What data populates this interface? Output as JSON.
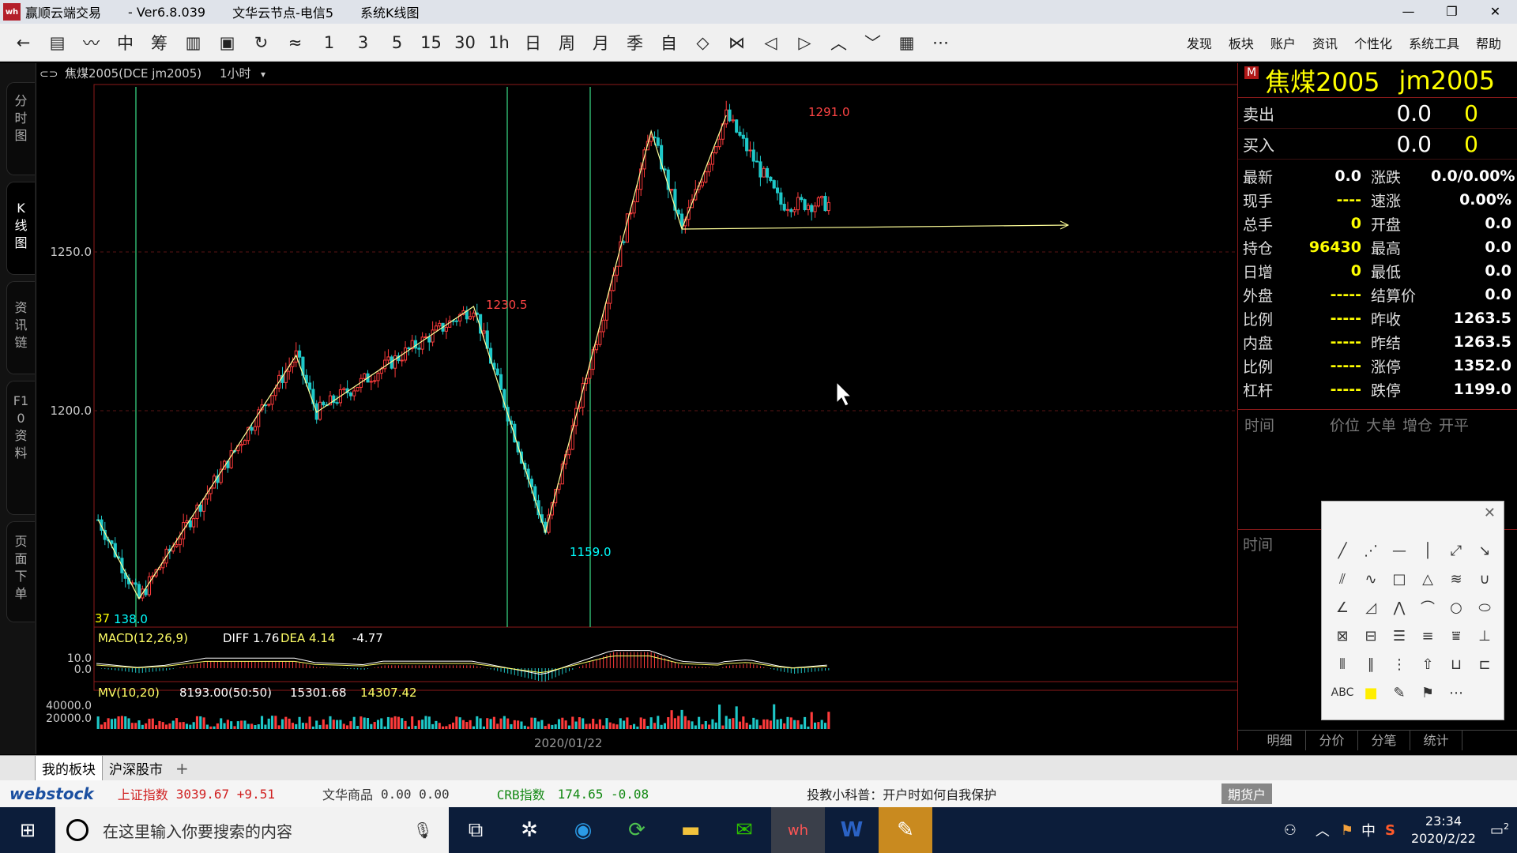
{
  "window": {
    "logo": "wh",
    "app_name": "赢顺云端交易",
    "version": "- Ver6.8.039",
    "server": "文华云节点-电信5",
    "module": "系统K线图",
    "controls": [
      "—",
      "❐",
      "✕"
    ]
  },
  "toolbar": {
    "buttons": [
      "←",
      "▤",
      "〰",
      "中",
      "筹",
      "▥",
      "▣",
      "↻",
      "≈",
      "1",
      "3",
      "5",
      "15",
      "30",
      "1h",
      "日",
      "周",
      "月",
      "季",
      "自",
      "◇",
      "⋈",
      "◁",
      "▷",
      "︿",
      "﹀",
      "▦",
      "⋯"
    ],
    "menu": [
      "发现",
      "板块",
      "账户",
      "资讯",
      "个性化",
      "系统工具",
      "帮助"
    ]
  },
  "left_rail": [
    "分时图",
    "K线图",
    "资讯链",
    "F10资料",
    "页面下单"
  ],
  "chart": {
    "symbol_line": "焦煤2005(DCE jm2005)",
    "period": "1小时",
    "price_ticks": [
      "1250.0",
      "1200.0"
    ],
    "macd_label": "MACD(12,26,9)",
    "macd_diff": "DIFF 1.76",
    "macd_dea": "DEA 4.14",
    "macd_value": "-4.77",
    "macd_ticks": [
      "10.0",
      "0.0"
    ],
    "mv_label": "MV(10,20)",
    "mv_values": [
      "8193.00(50:50)",
      "15301.68",
      "14307.42"
    ],
    "mv_ticks": [
      "40000.0",
      "20000.0"
    ],
    "date_label": "2020/01/22",
    "annotations": [
      "1291.0",
      "1230.5",
      "1159.0",
      "138.0",
      "37"
    ]
  },
  "chart_data": {
    "type": "candlestick",
    "ylim": [
      1130,
      1300
    ],
    "points": [
      {
        "label": "start",
        "value": 1163
      },
      {
        "label": "low",
        "value": 1138.0
      },
      {
        "label": "swing-high",
        "value": 1215
      },
      {
        "label": "swing-low",
        "value": 1197
      },
      {
        "label": "high",
        "value": 1230.5
      },
      {
        "label": "low",
        "value": 1159.0
      },
      {
        "label": "peak",
        "value": 1286
      },
      {
        "label": "pullback",
        "value": 1255
      },
      {
        "label": "high",
        "value": 1291.0
      },
      {
        "label": "last",
        "value": 1263
      }
    ]
  },
  "quote": {
    "badge": "M",
    "name": "焦煤2005",
    "code": "jm2005",
    "sell_label": "卖出",
    "sell_price": "0.0",
    "sell_qty": "0",
    "buy_label": "买入",
    "buy_price": "0.0",
    "buy_qty": "0",
    "rows": [
      {
        "l": "最新",
        "v": "0.0",
        "l2": "涨跌",
        "v2": "0.0/0.00%"
      },
      {
        "l": "现手",
        "v": "----",
        "l2": "速涨",
        "v2": "0.00%"
      },
      {
        "l": "总手",
        "v": "0",
        "l2": "开盘",
        "v2": "0.0"
      },
      {
        "l": "持仓",
        "v": "96430",
        "l2": "最高",
        "v2": "0.0"
      },
      {
        "l": "日增",
        "v": "0",
        "l2": "最低",
        "v2": "0.0"
      },
      {
        "l": "外盘",
        "v": "-----",
        "l2": "结算价",
        "v2": "0.0"
      },
      {
        "l": "比例",
        "v": "-----",
        "l2": "昨收",
        "v2": "1263.5"
      },
      {
        "l": "内盘",
        "v": "-----",
        "l2": "昨结",
        "v2": "1263.5"
      },
      {
        "l": "比例",
        "v": "-----",
        "l2": "涨停",
        "v2": "1352.0"
      },
      {
        "l": "杠杆",
        "v": "-----",
        "l2": "跌停",
        "v2": "1199.0"
      }
    ],
    "ticks_header": [
      "时间",
      "价位",
      "大单",
      "增仓",
      "开平"
    ],
    "ticks2_header": "时间",
    "tabs": [
      "明细",
      "分价",
      "分笔",
      "统计"
    ]
  },
  "draw_panel": {
    "close": "✕",
    "tools": [
      "╱",
      "⋰",
      "—",
      "│",
      "⤢",
      "↘",
      "⫽",
      "∿",
      "□",
      "△",
      "≋",
      "∪",
      "∠",
      "◿",
      "⋀",
      "⌒",
      "○",
      "⬭",
      "⊠",
      "⊟",
      "☰",
      "≡",
      "⩸",
      "⊥",
      "⦀",
      "∥",
      "⋮",
      "⇧",
      "⊔",
      "⊏",
      "ABC",
      "■",
      "✎",
      "⚑",
      "⋯"
    ]
  },
  "bottom_tabs": [
    "我的板块",
    "沪深股市",
    "+"
  ],
  "ticker": {
    "brand": "webstock",
    "items": [
      {
        "name": "上证指数",
        "value": "3039.67 +9.51"
      },
      {
        "name": "文华商品",
        "value": "0.00 0.00"
      },
      {
        "name": "CRB指数",
        "value": "174.65 -0.08"
      }
    ],
    "notice": "投教小科普：开户时如何自我保护",
    "account_btn": "期货户"
  },
  "taskbar": {
    "search_placeholder": "在这里输入你要搜索的内容",
    "time": "23:34",
    "date": "2020/2/22",
    "tray": [
      "中",
      "S"
    ],
    "notify": "2"
  }
}
